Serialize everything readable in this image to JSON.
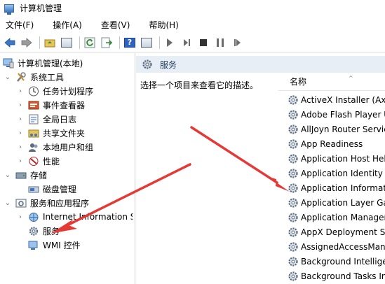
{
  "window": {
    "title": "计算机管理"
  },
  "menu": {
    "file": "文件(F)",
    "action": "操作(A)",
    "view": "查看(V)",
    "help": "帮助(H)"
  },
  "tree": {
    "root": "计算机管理(本地)",
    "system_tools": "系统工具",
    "task_scheduler": "任务计划程序",
    "event_viewer": "事件查看器",
    "global_log": "全局日志",
    "shared_folders": "共享文件夹",
    "local_users": "本地用户和组",
    "performance": "性能",
    "storage": "存储",
    "disk_management": "磁盘管理",
    "services_apps": "服务和应用程序",
    "iis": "Internet Information S",
    "services": "服务",
    "wmi": "WMI 控件"
  },
  "right": {
    "header_title": "服务",
    "description": "选择一个项目来查看它的描述。",
    "column_name": "名称",
    "services": [
      "ActiveX Installer (AxIn",
      "Adobe Flash Player U",
      "AllJoyn Router Servic",
      "App Readiness",
      "Application Host Hel",
      "Application Identity",
      "Application Informat",
      "Application Layer Ga",
      "Application Manager",
      "AppX Deployment Se",
      "AssignedAccessMana",
      "Background Intellige",
      "Background Tasks In"
    ]
  },
  "colors": {
    "arrow": "#e53935",
    "header_bg": "#e8eef6",
    "selection": "#cce8ff"
  }
}
